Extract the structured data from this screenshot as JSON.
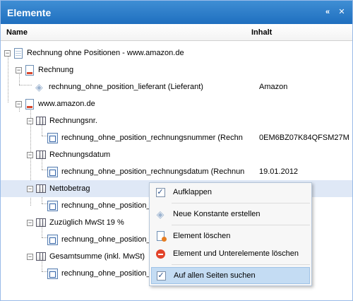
{
  "panel": {
    "title": "Elemente"
  },
  "columns": {
    "name": "Name",
    "content": "Inhalt"
  },
  "tree": [
    {
      "label": "Rechnung ohne Positionen - www.amazon.de",
      "value": ""
    },
    {
      "label": "Rechnung",
      "value": ""
    },
    {
      "label": "rechnung_ohne_position_lieferant (Lieferant)",
      "value": "Amazon"
    },
    {
      "label": "www.amazon.de",
      "value": ""
    },
    {
      "label": "Rechnungsnr.",
      "value": ""
    },
    {
      "label": "rechnung_ohne_position_rechnungsnummer (Rechn",
      "value": "0EM6BZ07K84QFSM27M..."
    },
    {
      "label": "Rechnungsdatum",
      "value": ""
    },
    {
      "label": "rechnung_ohne_position_rechnungsdatum (Rechnun",
      "value": "19.01.2012"
    },
    {
      "label": "Nettobetrag",
      "value": ""
    },
    {
      "label": "rechnung_ohne_position_",
      "value": ""
    },
    {
      "label": "Zuzüglich MwSt 19 %",
      "value": ""
    },
    {
      "label": "rechnung_ohne_position_",
      "value": ""
    },
    {
      "label": "Gesamtsumme (inkl. MwSt)",
      "value": ""
    },
    {
      "label": "rechnung_ohne_position_",
      "value": ""
    }
  ],
  "context_menu": {
    "items": [
      {
        "label": "Aufklappen"
      },
      {
        "label": "Neue Konstante erstellen"
      },
      {
        "label": "Element löschen"
      },
      {
        "label": "Element und Unterelemente löschen"
      },
      {
        "label": "Auf allen Seiten suchen"
      }
    ]
  }
}
